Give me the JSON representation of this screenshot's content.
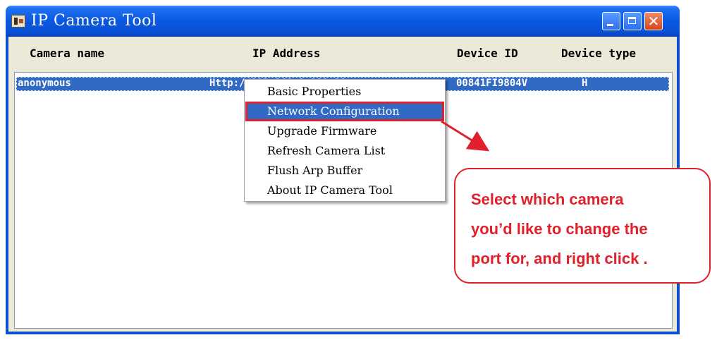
{
  "window": {
    "title": "IP Camera Tool",
    "icons": {
      "app": "camera-tool-app-icon",
      "minimize": "minimize-icon",
      "maximize": "maximize-icon",
      "close": "close-icon"
    },
    "close_glyph": "✕"
  },
  "columns": [
    "Camera name",
    "IP Address",
    "Device ID",
    "Device type"
  ],
  "cameras": [
    {
      "name": "anonymous",
      "ip": "Http://192.168.1.111:88",
      "device_id": "00841FI9804V",
      "device_type": "H",
      "selected": true
    }
  ],
  "context_menu": {
    "items": [
      "Basic Properties",
      "Network Configuration",
      "Upgrade Firmware",
      "Refresh Camera List",
      "Flush Arp Buffer",
      "About IP Camera Tool"
    ],
    "highlighted_index": 1
  },
  "callout": {
    "lines": [
      "Select which camera",
      "you’d like to change the",
      "port for, and right click ."
    ]
  },
  "colors": {
    "titlebar": "#0a58e0",
    "selection": "#316ac5",
    "annotation": "#e0202a",
    "client": "#ece9d8"
  }
}
